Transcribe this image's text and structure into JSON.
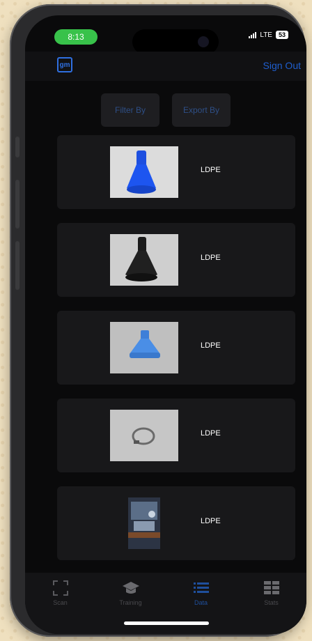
{
  "status": {
    "time": "8:13",
    "network": "LTE",
    "battery": "53"
  },
  "header": {
    "logo_text": "gm",
    "sign_out": "Sign Out"
  },
  "filters": {
    "filter_label": "Filter By",
    "export_label": "Export By"
  },
  "items": [
    {
      "label": "LDPE",
      "thumb": "blue-funnel-photo"
    },
    {
      "label": "LDPE",
      "thumb": "black-funnel-photo"
    },
    {
      "label": "LDPE",
      "thumb": "blue-cap-photo"
    },
    {
      "label": "LDPE",
      "thumb": "clear-ring-photo"
    },
    {
      "label": "LDPE",
      "thumb": "store-photo"
    }
  ],
  "tabs": [
    {
      "label": "Scan",
      "icon": "scan-icon"
    },
    {
      "label": "Training",
      "icon": "graduation-cap-icon"
    },
    {
      "label": "Data",
      "icon": "list-icon",
      "active": true
    },
    {
      "label": "Stats",
      "icon": "grid-icon"
    }
  ],
  "colors": {
    "accent": "#1f5fcf",
    "status_green": "#38c24a",
    "background": "#0a0a0b"
  }
}
